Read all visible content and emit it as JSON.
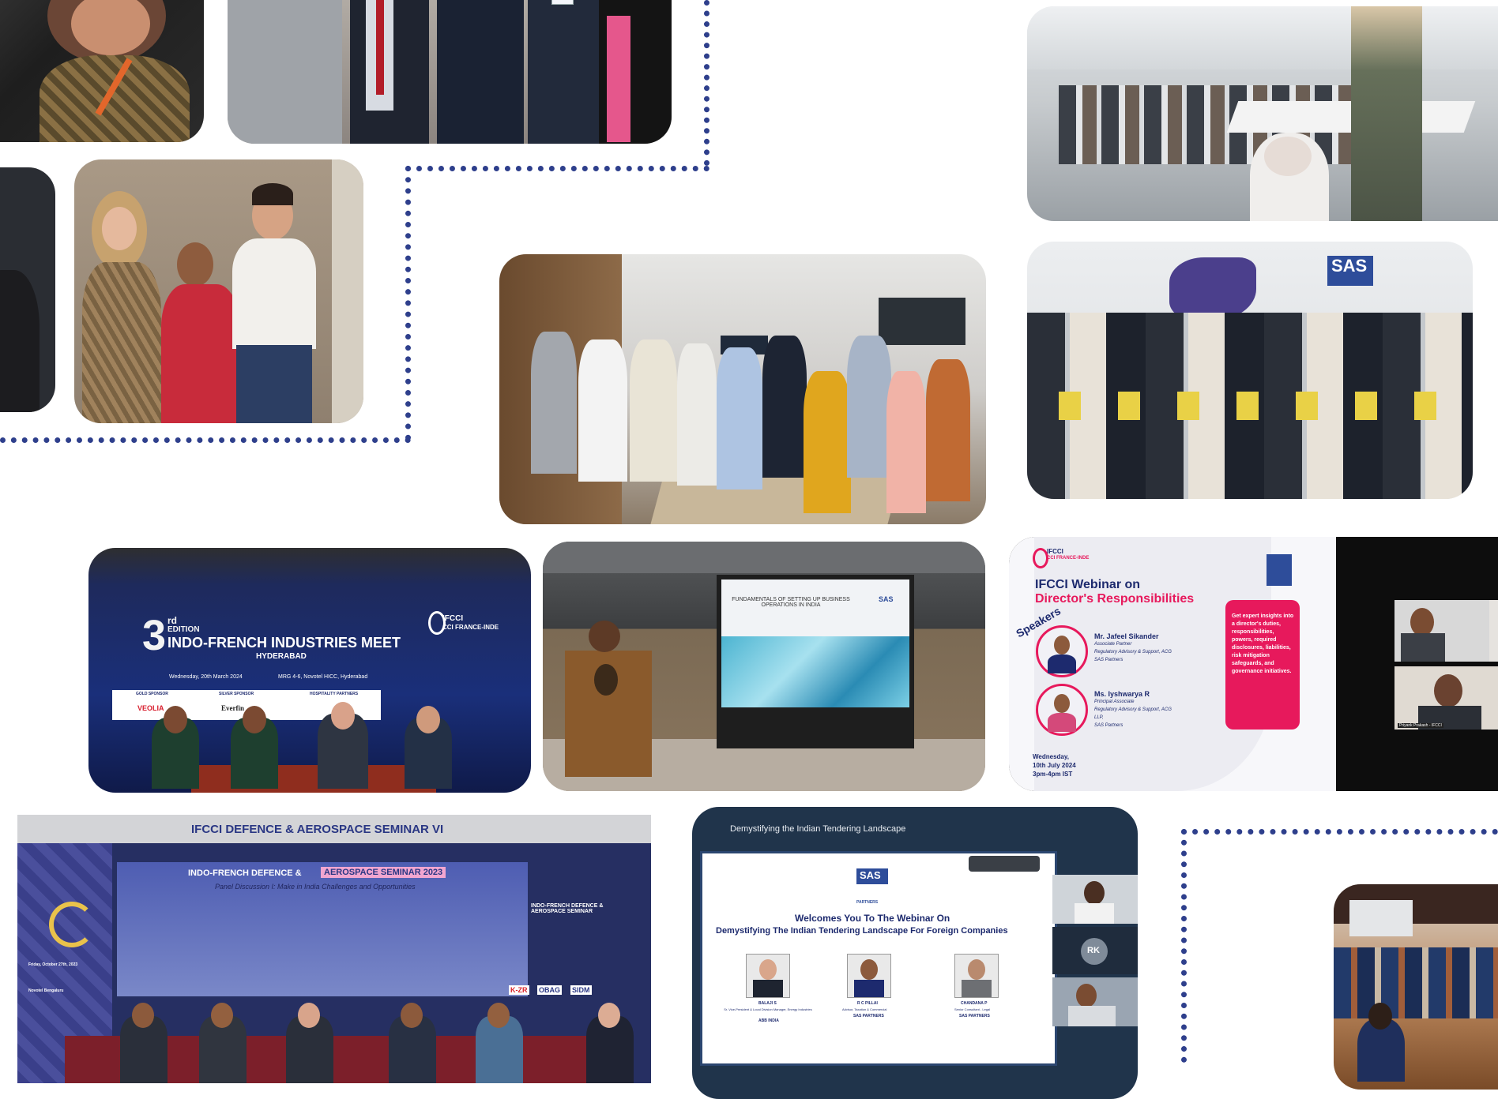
{
  "banner_indo_french": {
    "edition": "3",
    "edition_sup": "rd",
    "edition_word": "EDITION",
    "title": "INDO-FRENCH INDUSTRIES MEET",
    "city": "HYDERABAD",
    "date_line": "Wednesday, 20th March 2024",
    "venue_line": "MRG 4-6, Novotel HICC, Hyderabad",
    "org": "IFCCI",
    "org_sub": "CCI FRANCE-INDE",
    "sponsor_labels": [
      "GOLD SPONSOR",
      "SILVER SPONSOR",
      "HOSPITALITY PARTNERS"
    ],
    "sponsors": [
      "VEOLIA",
      "Everfin"
    ]
  },
  "projector_slide": {
    "title": "FUNDAMENTALS OF SETTING UP BUSINESS OPERATIONS IN INDIA",
    "logo": "SAS"
  },
  "webinar_directors": {
    "org": "IFCCI",
    "org_sub": "CCI FRANCE-INDE",
    "heading_1": "IFCCI Webinar on",
    "heading_2": "Director's Responsibilities",
    "speakers_tag": "Speakers",
    "speaker_1_name": "Mr. Jafeel Sikander",
    "speaker_1_role": "Associate Partner",
    "speaker_1_desc": "Regulatory Advisory & Support, ACG",
    "speaker_1_firm": "SAS Partners",
    "speaker_2_name": "Ms. Iyshwarya R",
    "speaker_2_role": "Principal Associate",
    "speaker_2_desc": "Regulatory Advisory & Support, ACG",
    "speaker_2_desc2": "LLP,",
    "speaker_2_firm": "SAS Partners",
    "date_1": "Wednesday,",
    "date_2": "10th July 2024",
    "time": "3pm-4pm IST",
    "pink_box": "Get expert insights into a director's duties, responsibilities, powers, required disclosures, liabilities, risk mitigation safeguards, and governance initiatives.",
    "participant_caption": "Priyank Prakash - IFCCI"
  },
  "defence_banner": {
    "top_title": "IFCCI DEFENCE & AEROSPACE SEMINAR VI",
    "main_title_a": "INDO-FRENCH DEFENCE &",
    "main_title_b": "AEROSPACE SEMINAR 2023",
    "subtitle": "Panel Discussion I: Make in India Challenges and Opportunities",
    "side_title": "INDO-FRENCH DEFENCE & AEROSPACE SEMINAR",
    "date": "Friday, October 27th, 2023",
    "venue": "Novotel Bengaluru",
    "sponsors": [
      "K-ZR",
      "OBAG",
      "SIDM"
    ]
  },
  "tendering_webinar": {
    "window_title": "Demystifying the Indian Tendering Landscape",
    "logo": "SAS",
    "logo_sub": "PARTNERS",
    "welcome_line": "Welcomes You To The Webinar On",
    "title_line": "Demystifying The Indian Tendering Landscape For Foreign Companies",
    "speaker_1_name": "BALAJI S",
    "speaker_1_role": "Sr. Vice-President & Local Division Manager, Energy Industries",
    "speaker_1_org": "ABB INDIA",
    "speaker_2_name": "R C PILLAI",
    "speaker_2_role": "Advisor, Taxation & Commercial",
    "speaker_2_org": "SAS PARTNERS",
    "speaker_3_name": "CHANDANA P",
    "speaker_3_role": "Senior Consultant - Legal",
    "speaker_3_org": "SAS PARTNERS",
    "participant_initials": "RK"
  },
  "sas_banner": {
    "logo": "SAS"
  },
  "colors": {
    "dots": "#2e3f8c",
    "pink": "#e7195c",
    "navy": "#1d2a6e"
  }
}
